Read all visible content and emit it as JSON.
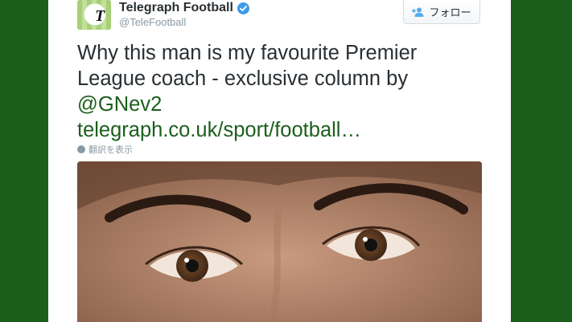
{
  "account": {
    "display_name": "Telegraph Football",
    "handle": "@TeleFootball",
    "avatar_letter": "T",
    "verified": true
  },
  "follow_button": {
    "label": "フォロー",
    "icon": "add-user-icon"
  },
  "tweet": {
    "text_line1": "Why this man is my favourite Premier",
    "text_line2": "League coach - exclusive column by",
    "mention": "@GNev2",
    "link": "telegraph.co.uk/sport/football…"
  },
  "translate": {
    "label": "翻訳を表示",
    "icon": "globe-icon"
  },
  "photo": {
    "subject": "close-up-eyes-photo"
  },
  "colors": {
    "background": "#1c5e1c",
    "link": "#1c5e1c",
    "text": "#292f33",
    "muted": "#8899a6",
    "verified": "#3d9be9"
  }
}
